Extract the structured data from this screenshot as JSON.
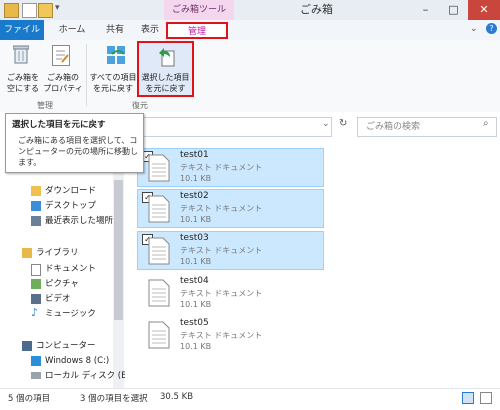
{
  "window": {
    "title": "ごみ箱",
    "context_tool": "ごみ箱ツール",
    "minimize": "–",
    "maximize": "□",
    "close": "✕"
  },
  "tabs": {
    "file": "ファイル",
    "home": "ホーム",
    "share": "共有",
    "view": "表示",
    "manage": "管理"
  },
  "ribbon": {
    "empty_bin": [
      "ごみ箱を",
      "空にする"
    ],
    "bin_props": [
      "ごみ箱の",
      "プロパティ"
    ],
    "group_manage": "管理",
    "restore_all": [
      "すべての項目",
      "を元に戻す"
    ],
    "restore_selected": [
      "選択した項目",
      "を元に戻す"
    ],
    "group_restore": "復元"
  },
  "tooltip": {
    "title": "選択した項目を元に戻す",
    "body": "ごみ箱にある項目を選択して、コンピューターの元の場所に移動します。"
  },
  "search": {
    "placeholder": "ごみ箱の検索"
  },
  "nav": {
    "downloads": "ダウンロード",
    "desktop": "デスクトップ",
    "recent": "最近表示した場所",
    "libraries": "ライブラリ",
    "documents": "ドキュメント",
    "pictures": "ピクチャ",
    "videos": "ビデオ",
    "music": "ミュージック",
    "computer": "コンピューター",
    "win8": "Windows 8 (C:)",
    "local_disk": "ローカル ディスク (E"
  },
  "files": [
    {
      "name": "test01",
      "type": "テキスト ドキュメント",
      "size": "10.1 KB",
      "selected": true
    },
    {
      "name": "test02",
      "type": "テキスト ドキュメント",
      "size": "10.1 KB",
      "selected": true
    },
    {
      "name": "test03",
      "type": "テキスト ドキュメント",
      "size": "10.1 KB",
      "selected": true
    },
    {
      "name": "test04",
      "type": "テキスト ドキュメント",
      "size": "10.1 KB",
      "selected": false
    },
    {
      "name": "test05",
      "type": "テキスト ドキュメント",
      "size": "10.1 KB",
      "selected": false
    }
  ],
  "status": {
    "count": "5 個の項目",
    "selection": "3 個の項目を選択",
    "size": "30.5 KB"
  },
  "colors": {
    "accent": "#1979ca",
    "selection": "#cce8ff",
    "highlight": "#e2121a",
    "context": "#f4d7ee"
  }
}
